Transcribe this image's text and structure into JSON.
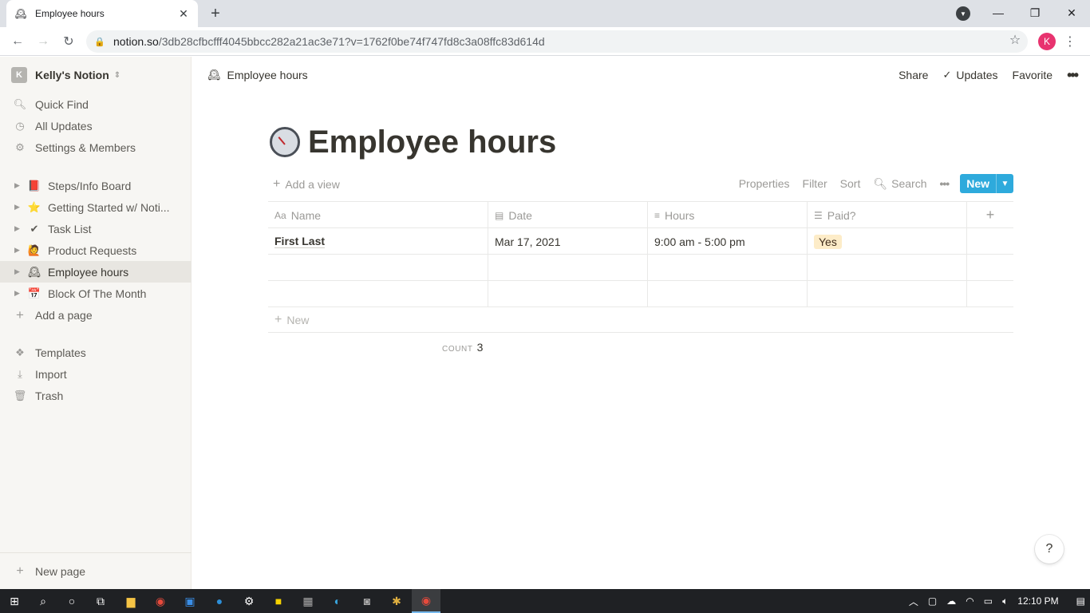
{
  "browser": {
    "tab_title": "Employee hours",
    "tab_close": "✕",
    "new_tab": "+",
    "url_host": "notion.so",
    "url_path": "/3db28cfbcfff4045bbcc282a21ac3e71?v=1762f0be74f747fd8c3a08ffc83d614d",
    "profile_initial": "K",
    "win_min": "—",
    "win_max": "❐",
    "win_close": "✕"
  },
  "sidebar": {
    "workspace_initial": "K",
    "workspace_name": "Kelly's Notion",
    "actions": [
      {
        "label": "Quick Find",
        "icon": "search-icon"
      },
      {
        "label": "All Updates",
        "icon": "clock-icon"
      },
      {
        "label": "Settings & Members",
        "icon": "gear-icon"
      }
    ],
    "pages": [
      {
        "label": "Steps/Info Board",
        "emoji": "📕"
      },
      {
        "label": "Getting Started w/ Noti...",
        "emoji": "⭐"
      },
      {
        "label": "Task List",
        "emoji": "✔"
      },
      {
        "label": "Product Requests",
        "emoji": "🙋"
      },
      {
        "label": "Employee hours",
        "emoji": "🕰"
      },
      {
        "label": "Block Of The Month",
        "emoji": "📅"
      }
    ],
    "add_page": "Add a page",
    "tools": [
      {
        "label": "Templates",
        "icon": "templates-icon"
      },
      {
        "label": "Import",
        "icon": "import-icon"
      },
      {
        "label": "Trash",
        "icon": "trash-icon"
      }
    ],
    "new_page": "New page"
  },
  "topbar": {
    "breadcrumb": "Employee hours",
    "share": "Share",
    "updates": "Updates",
    "favorite": "Favorite"
  },
  "page": {
    "title": "Employee hours",
    "add_view": "Add a view",
    "properties": "Properties",
    "filter": "Filter",
    "sort": "Sort",
    "search": "Search",
    "new_button": "New"
  },
  "table": {
    "columns": [
      "Name",
      "Date",
      "Hours",
      "Paid?"
    ],
    "rows": [
      {
        "name": "First Last",
        "date": "Mar 17, 2021",
        "hours": "9:00 am - 5:00 pm",
        "paid": "Yes"
      },
      {
        "name": "",
        "date": "",
        "hours": "",
        "paid": ""
      },
      {
        "name": "",
        "date": "",
        "hours": "",
        "paid": ""
      }
    ],
    "new_row": "New",
    "count_label": "COUNT",
    "count_value": "3"
  },
  "help": "?",
  "taskbar": {
    "time": "12:10 PM"
  },
  "colors": {
    "accent": "#2eaadc",
    "sidebar_bg": "#f7f6f3",
    "tag_yes": "#fdecc8"
  }
}
